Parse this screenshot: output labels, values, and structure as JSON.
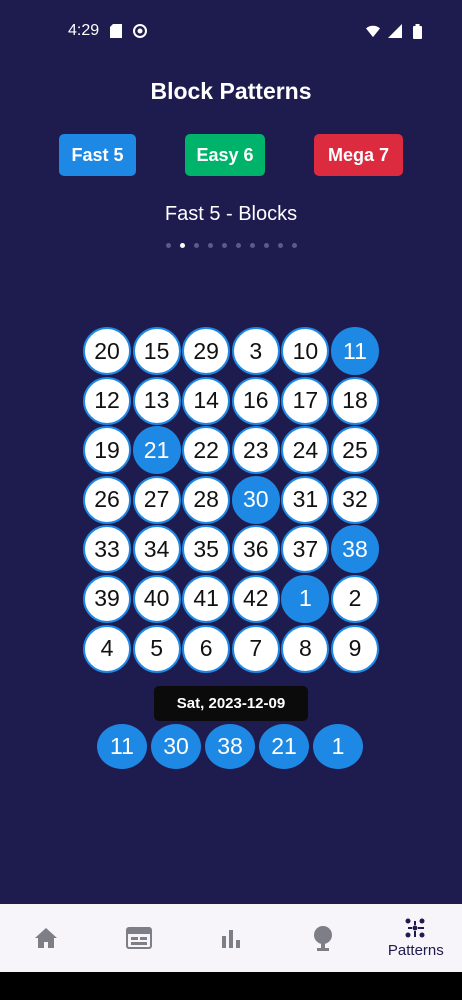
{
  "status_bar": {
    "time": "4:29"
  },
  "title": "Block Patterns",
  "games": [
    {
      "label": "Fast 5",
      "color": "#1e88e5"
    },
    {
      "label": "Easy 6",
      "color": "#00b36b"
    },
    {
      "label": "Mega 7",
      "color": "#dc2b3f"
    }
  ],
  "subtitle": "Fast 5 - Blocks",
  "pager": {
    "count": 10,
    "active_index": 1
  },
  "grid": {
    "rows": [
      [
        20,
        15,
        29,
        3,
        10,
        11
      ],
      [
        12,
        13,
        14,
        16,
        17,
        18
      ],
      [
        19,
        21,
        22,
        23,
        24,
        25
      ],
      [
        26,
        27,
        28,
        30,
        31,
        32
      ],
      [
        33,
        34,
        35,
        36,
        37,
        38
      ],
      [
        39,
        40,
        41,
        42,
        1,
        2
      ],
      [
        4,
        5,
        6,
        7,
        8,
        9
      ]
    ],
    "highlighted": [
      11,
      21,
      30,
      38,
      1
    ]
  },
  "draw": {
    "date": "Sat, 2023-12-09",
    "numbers": [
      11,
      30,
      38,
      21,
      1
    ]
  },
  "nav": [
    {
      "icon": "home-icon",
      "label": ""
    },
    {
      "icon": "calendar-icon",
      "label": ""
    },
    {
      "icon": "bar-chart-icon",
      "label": ""
    },
    {
      "icon": "ball-icon",
      "label": ""
    },
    {
      "icon": "patterns-icon",
      "label": "Patterns"
    }
  ],
  "colors": {
    "background": "#1e1b4e",
    "accent": "#1e88e5",
    "nav_background": "#f7f4fa"
  }
}
